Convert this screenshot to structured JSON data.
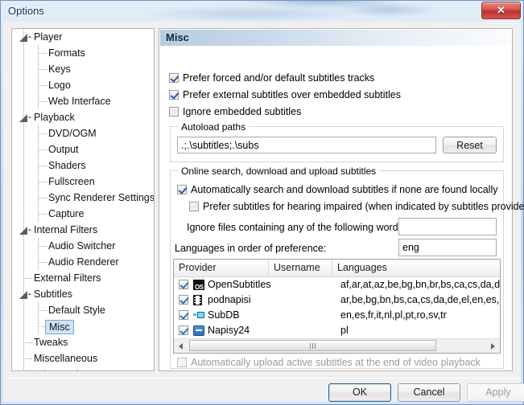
{
  "window": {
    "title": "Options",
    "close_label": "✕"
  },
  "tree": {
    "items": [
      {
        "label": "Player",
        "level": 0,
        "expandable": true,
        "selected": false
      },
      {
        "label": "Formats",
        "level": 1,
        "expandable": false,
        "selected": false
      },
      {
        "label": "Keys",
        "level": 1,
        "expandable": false,
        "selected": false
      },
      {
        "label": "Logo",
        "level": 1,
        "expandable": false,
        "selected": false
      },
      {
        "label": "Web Interface",
        "level": 1,
        "expandable": false,
        "selected": false
      },
      {
        "label": "Playback",
        "level": 0,
        "expandable": true,
        "selected": false
      },
      {
        "label": "DVD/OGM",
        "level": 1,
        "expandable": false,
        "selected": false
      },
      {
        "label": "Output",
        "level": 1,
        "expandable": false,
        "selected": false
      },
      {
        "label": "Shaders",
        "level": 1,
        "expandable": false,
        "selected": false
      },
      {
        "label": "Fullscreen",
        "level": 1,
        "expandable": false,
        "selected": false
      },
      {
        "label": "Sync Renderer Settings",
        "level": 1,
        "expandable": false,
        "selected": false
      },
      {
        "label": "Capture",
        "level": 1,
        "expandable": false,
        "selected": false
      },
      {
        "label": "Internal Filters",
        "level": 0,
        "expandable": true,
        "selected": false
      },
      {
        "label": "Audio Switcher",
        "level": 1,
        "expandable": false,
        "selected": false
      },
      {
        "label": "Audio Renderer",
        "level": 1,
        "expandable": false,
        "selected": false
      },
      {
        "label": "External Filters",
        "level": 0,
        "expandable": false,
        "selected": false
      },
      {
        "label": "Subtitles",
        "level": 0,
        "expandable": true,
        "selected": false
      },
      {
        "label": "Default Style",
        "level": 1,
        "expandable": false,
        "selected": false
      },
      {
        "label": "Misc",
        "level": 1,
        "expandable": false,
        "selected": true
      },
      {
        "label": "Tweaks",
        "level": 0,
        "expandable": false,
        "selected": false
      },
      {
        "label": "Miscellaneous",
        "level": 0,
        "expandable": false,
        "selected": false
      },
      {
        "label": "Advanced",
        "level": 0,
        "expandable": false,
        "selected": false
      }
    ]
  },
  "pane": {
    "banner_title": "Misc",
    "checkboxes": [
      {
        "label": "Prefer forced and/or default subtitles tracks",
        "checked": true
      },
      {
        "label": "Prefer external subtitles over embedded subtitles",
        "checked": true
      },
      {
        "label": "Ignore embedded subtitles",
        "checked": false
      }
    ],
    "autoload": {
      "legend": "Autoload paths",
      "value": ".;.\\subtitles;.\\subs",
      "reset_label": "Reset"
    },
    "online": {
      "legend": "Online search, download and upload subtitles",
      "auto_search": {
        "label": "Automatically search and download subtitles if none are found locally",
        "checked": true
      },
      "hearing_impaired": {
        "label": "Prefer subtitles for hearing impaired (when indicated by subtitles provider)",
        "checked": false
      },
      "ignore_files_label": "Ignore files containing any of the following word(s):",
      "ignore_files_value": "",
      "languages_label": "Languages in order of preference:",
      "languages_value": "eng",
      "auto_upload": {
        "label": "Automatically upload active subtitles at the end of video playback",
        "checked": false,
        "disabled": true
      }
    },
    "provider_table": {
      "columns": [
        "Provider",
        "Username",
        "Languages"
      ],
      "rows": [
        {
          "checked": true,
          "icon": "opensubtitles-icon",
          "provider": "OpenSubtitles",
          "username": "",
          "languages": "af,ar,at,az,be,bg,bn,br,bs,ca,cs,da,de,el"
        },
        {
          "checked": true,
          "icon": "podnapisi-icon",
          "provider": "podnapisi",
          "username": "",
          "languages": "ar,be,bg,bn,bs,ca,cs,da,de,el,en,es,et,fa"
        },
        {
          "checked": true,
          "icon": "subdb-icon",
          "provider": "SubDB",
          "username": "",
          "languages": "en,es,fr,it,nl,pl,pt,ro,sv,tr"
        },
        {
          "checked": true,
          "icon": "napisy24-icon",
          "provider": "Napisy24",
          "username": "",
          "languages": "pl"
        }
      ]
    }
  },
  "buttons": {
    "ok": "OK",
    "cancel": "Cancel",
    "apply": "Apply"
  }
}
